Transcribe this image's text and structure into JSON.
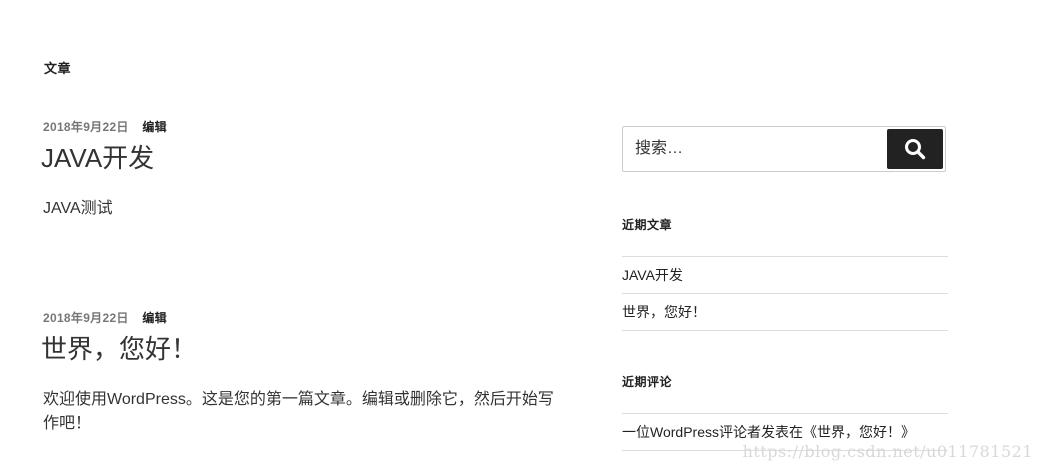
{
  "page": {
    "title": "文章"
  },
  "posts": [
    {
      "date": "2018年9月22日",
      "edit_label": "编辑",
      "title": "JAVA开发",
      "content": "JAVA测试"
    },
    {
      "date": "2018年9月22日",
      "edit_label": "编辑",
      "title": "世界，您好！",
      "content": "欢迎使用WordPress。这是您的第一篇文章。编辑或删除它，然后开始写作吧！"
    }
  ],
  "sidebar": {
    "search": {
      "placeholder": "搜索…",
      "button_icon": "search-icon"
    },
    "recent_posts": {
      "title": "近期文章",
      "items": [
        "JAVA开发",
        "世界，您好！"
      ]
    },
    "recent_comments": {
      "title": "近期评论",
      "items": [
        "一位WordPress评论者发表在《世界，您好！》"
      ]
    }
  },
  "watermark": "https://blog.csdn.net/u011781521",
  "colors": {
    "text": "#333333",
    "meta": "#767676",
    "button": "#222222",
    "border": "#dddddd"
  }
}
